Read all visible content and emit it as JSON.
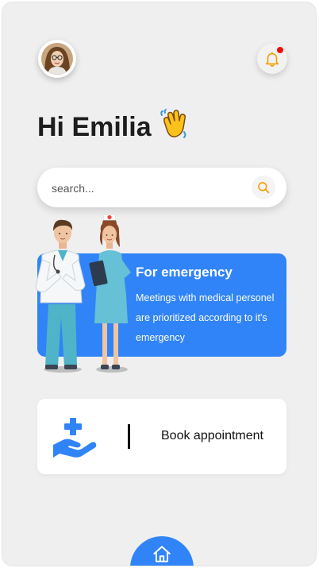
{
  "header": {
    "avatar_icon": "user-avatar-photo",
    "notification_icon": "bell-icon",
    "notification_dot_color": "#e8120c"
  },
  "greeting": {
    "text": "Hi Emilia",
    "emoji": "👋"
  },
  "search": {
    "placeholder": "search...",
    "icon": "search-icon"
  },
  "emergency": {
    "title": "For emergency",
    "description": "Meetings with medical personel are prioritized according to it's emergency",
    "color": "#3084f7"
  },
  "booking": {
    "label": "Book appointment",
    "icon": "medical-care-hand-icon"
  },
  "nav": {
    "home_icon": "home-icon"
  },
  "colors": {
    "accent": "#3084f7",
    "bell": "#f2a100",
    "background": "#efefef"
  }
}
